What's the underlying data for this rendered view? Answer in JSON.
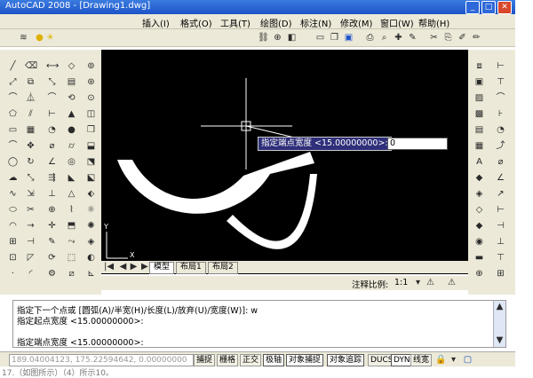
{
  "window": {
    "title": "AutoCAD 2008 - [Drawing1.dwg]",
    "min": "_",
    "max": "□",
    "close": "✕"
  },
  "menu": [
    {
      "label": "插入(I)"
    },
    {
      "label": "格式(O)"
    },
    {
      "label": "工具(T)"
    },
    {
      "label": "绘图(D)"
    },
    {
      "label": "标注(N)"
    },
    {
      "label": "修改(M)"
    },
    {
      "label": "窗口(W)"
    },
    {
      "label": "帮助(H)"
    }
  ],
  "layer": {
    "value": "0"
  },
  "dynamic_input": {
    "prompt": "指定端点宽度 <15.00000000>:",
    "value": "0"
  },
  "tabs": {
    "model": "模型",
    "layout1": "布局1",
    "layout2": "布局2"
  },
  "annotation_scale": {
    "label": "注释比例:",
    "value": "1:1"
  },
  "command": {
    "line1": "指定下一个点或 [圆弧(A)/半宽(H)/长度(L)/放弃(U)/宽度(W)]: w",
    "line2": "指定起点宽度 <15.00000000>:",
    "line3": "指定端点宽度 <15.00000000>:"
  },
  "status": {
    "coords": "189.04004123, 175.22594642, 0.00000000",
    "buttons": [
      "捕捉",
      "栅格",
      "正交",
      "极轴",
      "对象捕捉",
      "对象追踪",
      "DUCS",
      "DYN",
      "线宽"
    ]
  },
  "caption": "17.（如图所示）（4）所示10。",
  "axes": {
    "y": "Y",
    "x": "X"
  }
}
